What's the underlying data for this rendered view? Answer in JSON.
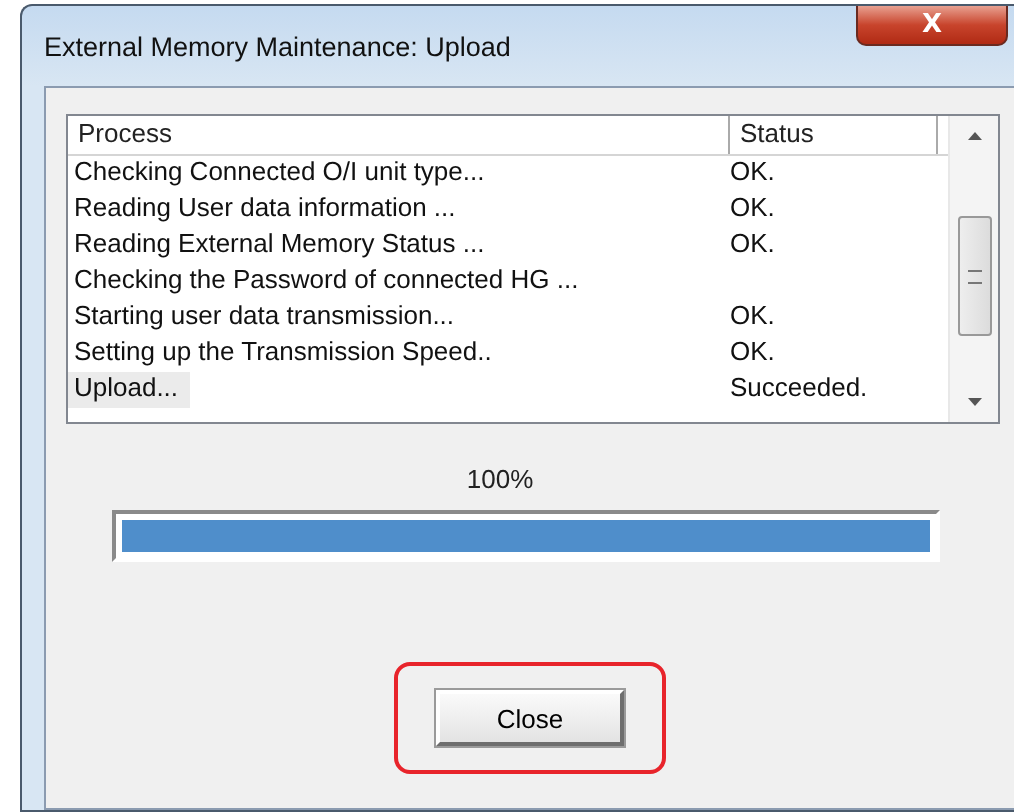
{
  "window": {
    "title": "External Memory Maintenance: Upload",
    "close_label": "X"
  },
  "table": {
    "columns": [
      "Process",
      "Status"
    ],
    "rows": [
      {
        "process": "Checking Connected O/I unit type...",
        "status": "OK.",
        "selected": false
      },
      {
        "process": "Reading User data information ...",
        "status": "OK.",
        "selected": false
      },
      {
        "process": "Reading External Memory Status ...",
        "status": "OK.",
        "selected": false
      },
      {
        "process": "Checking the Password of connected HG ...",
        "status": "",
        "selected": false
      },
      {
        "process": "Starting user data transmission...",
        "status": "OK.",
        "selected": false
      },
      {
        "process": "Setting up the Transmission Speed..",
        "status": "OK.",
        "selected": false
      },
      {
        "process": "Upload...",
        "status": "Succeeded.",
        "selected": true
      }
    ]
  },
  "progress": {
    "reading": "100%",
    "level": 1
  },
  "close_button": {
    "label": "Close",
    "highlighted": true
  }
}
